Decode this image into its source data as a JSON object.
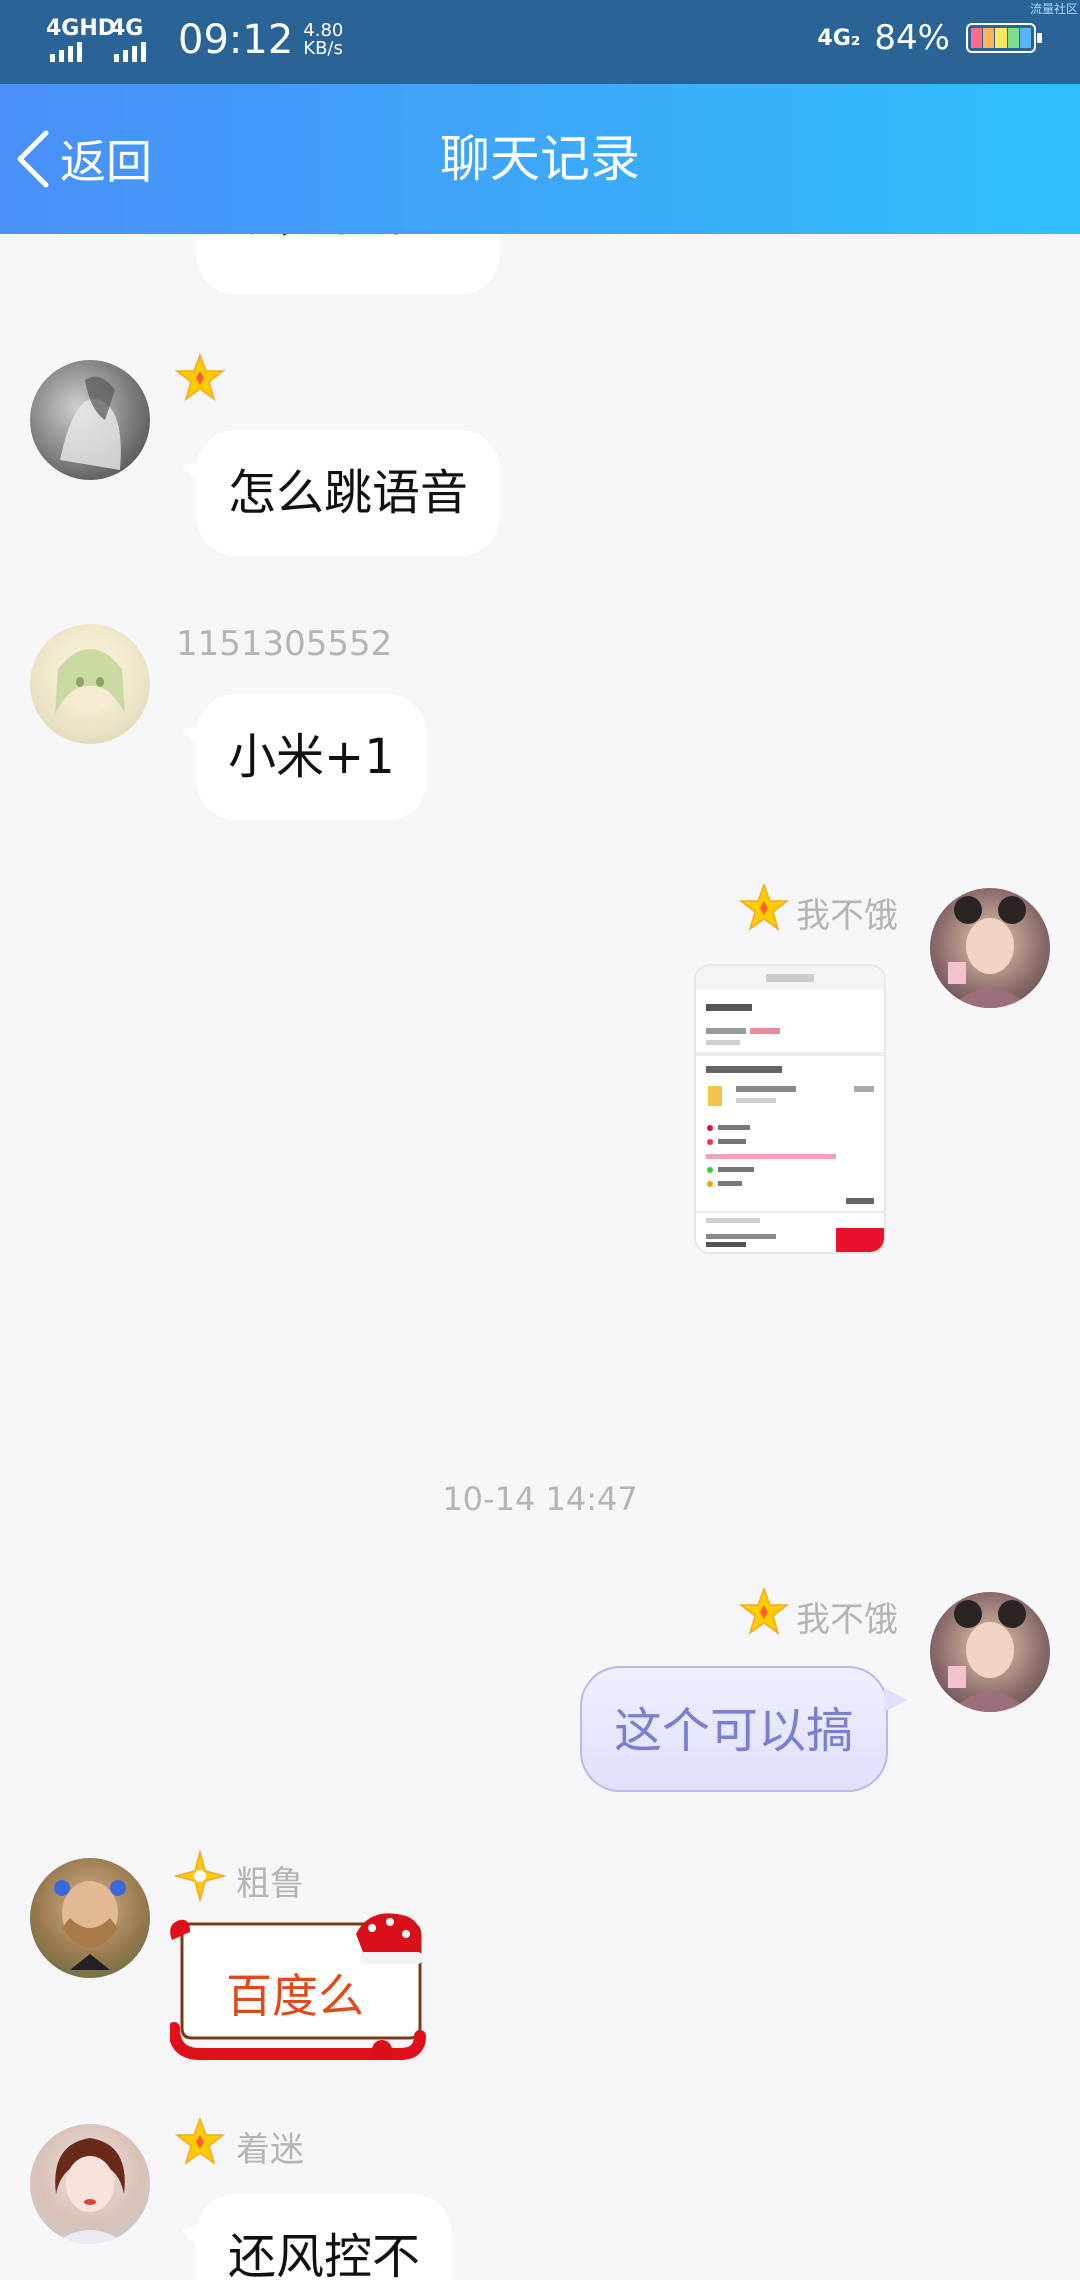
{
  "status_bar": {
    "network1": "4GHD",
    "network2": "4G",
    "time": "09:12",
    "speed_value": "4.80",
    "speed_unit": "KB/s",
    "network_right": "4G₂",
    "battery": "84%",
    "corner_text": "流量社区"
  },
  "header": {
    "back_label": "返回",
    "title": "聊天记录"
  },
  "messages": [
    {
      "text": "额，小米的"
    },
    {
      "text": "怎么跳语音"
    },
    {
      "sender": "1151305552",
      "text": "小米+1"
    },
    {
      "sender": "我不饿"
    },
    {
      "timestamp": "10-14 14:47"
    },
    {
      "sender": "我不饿",
      "text": "这个可以搞"
    },
    {
      "sender": "粗鲁",
      "text": "百度么"
    },
    {
      "sender": "着迷",
      "text": "还风控不"
    }
  ],
  "colors": {
    "header_left": "#4a8ff8",
    "header_right": "#2fc0fb",
    "status_bar": "#2a6496",
    "chat_bg": "#f6f6f9",
    "out_bubble_text": "#7a80cf",
    "xmas_text": "#e04a1a",
    "star": "#ffcc00"
  }
}
